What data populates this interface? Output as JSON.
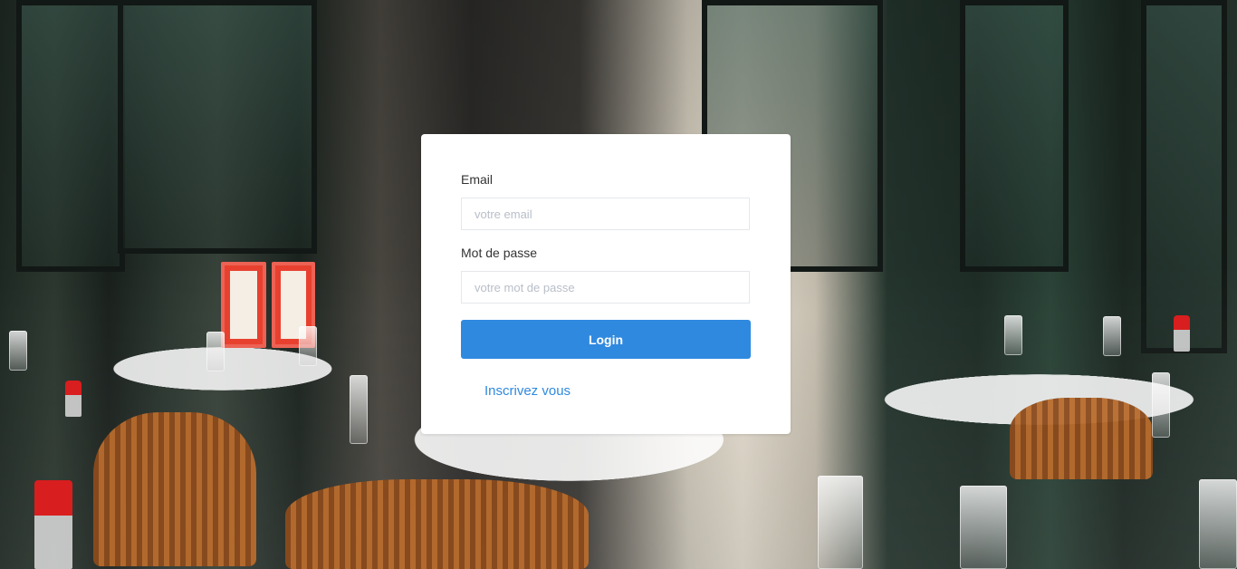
{
  "login_form": {
    "email_label": "Email",
    "email_placeholder": "votre email",
    "password_label": "Mot de passe",
    "password_placeholder": "votre mot de passe",
    "login_button": "Login",
    "signup_link": "Inscrivez vous"
  },
  "colors": {
    "card_background": "#ffffff",
    "accent": "#2f89df",
    "input_border": "#e5e7eb",
    "label_text": "#333333"
  }
}
